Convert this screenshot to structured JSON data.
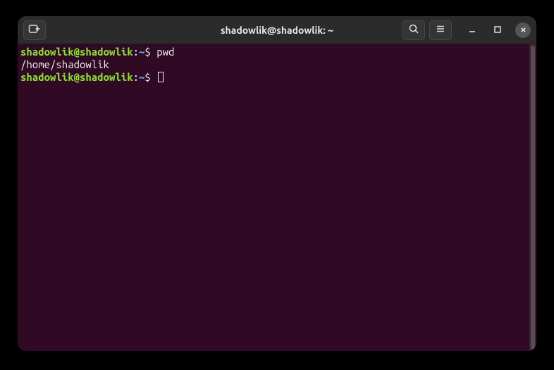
{
  "title": "shadowlik@shadowlik: ~",
  "prompt": {
    "userhost": "shadowlik@shadowlik",
    "sep": ":",
    "path": "~",
    "dollar": "$"
  },
  "lines": {
    "l0_cmd": " pwd",
    "l1_out": "/home/shadowlik",
    "l2_cmd": " "
  },
  "icons": {
    "newtab": "new-tab-icon",
    "search": "search-icon",
    "menu": "hamburger-menu-icon",
    "minimize": "minimize-icon",
    "maximize": "maximize-icon",
    "close": "close-icon"
  }
}
